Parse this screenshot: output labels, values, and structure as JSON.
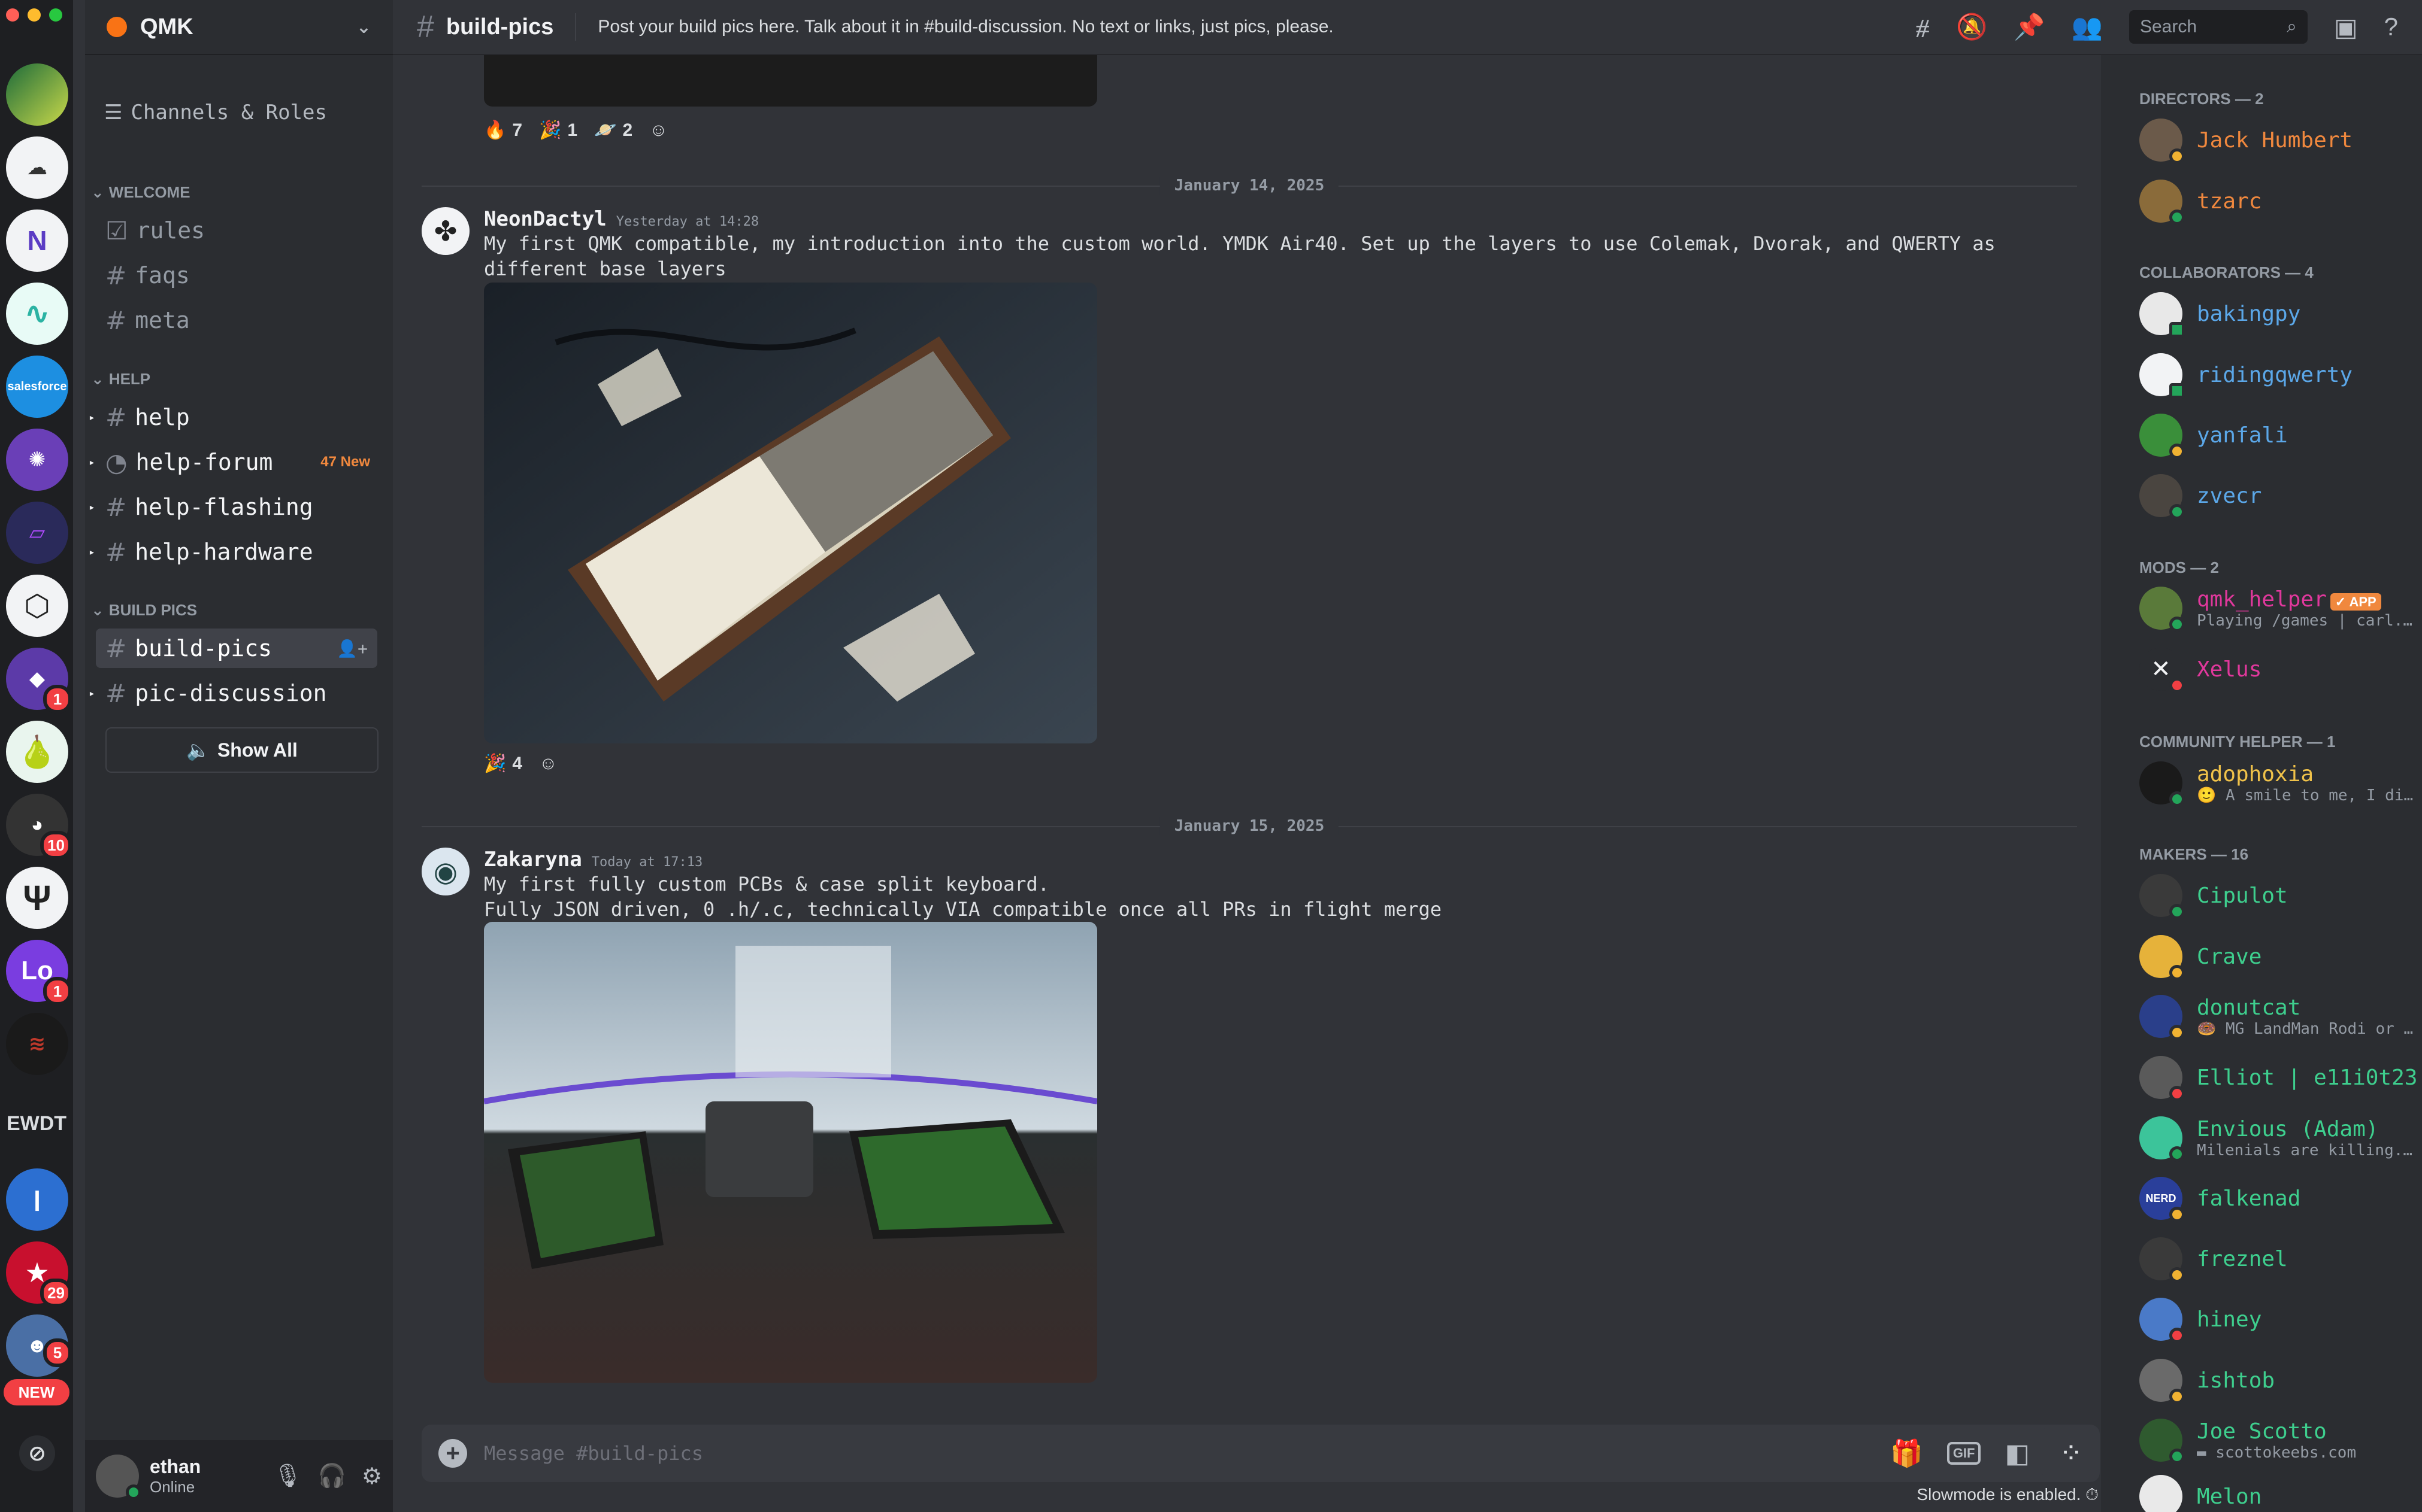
{
  "server": {
    "name": "QMK"
  },
  "channels_header": {
    "channels_roles": "Channels & Roles"
  },
  "categories": {
    "welcome": "WELCOME",
    "help": "HELP",
    "build": "BUILD PICS"
  },
  "channels": {
    "rules": "rules",
    "faqs": "faqs",
    "meta": "meta",
    "help": "help",
    "help_forum": "help-forum",
    "help_forum_new": "47 New",
    "help_flashing": "help-flashing",
    "help_hardware": "help-hardware",
    "build_pics": "build-pics",
    "pic_discussion": "pic-discussion"
  },
  "show_all": "Show All",
  "rail": {
    "ewdt": "EWDT",
    "new": "NEW",
    "badges": [
      "1",
      "10",
      "1",
      "29",
      "5"
    ]
  },
  "user": {
    "name": "ethan",
    "status": "Online"
  },
  "topbar": {
    "channel": "build-pics",
    "topic": "Post your build pics here. Talk about it in #build-discussion. No text or links, just pics, please.",
    "search_placeholder": "Search"
  },
  "messages": {
    "top_reactions": [
      {
        "emoji": "🔥",
        "count": "7"
      },
      {
        "emoji": "🎉",
        "count": "1"
      },
      {
        "emoji": "🪐",
        "count": "2"
      }
    ],
    "date1": "January 14, 2025",
    "m1": {
      "author": "NeonDactyl",
      "time": "Yesterday at 14:28",
      "text": "My first QMK compatible, my introduction into the custom world. YMDK Air40. Set up the layers to use Colemak, Dvorak, and QWERTY as\ndifferent base layers",
      "reactions": [
        {
          "emoji": "🎉",
          "count": "4"
        }
      ]
    },
    "date2": "January 15, 2025",
    "m2": {
      "author": "Zakaryna",
      "time": "Today at 17:13",
      "text": "My first fully custom PCBs & case split keyboard.\nFully JSON driven, 0 .h/.c, technically VIA compatible once all PRs in flight merge"
    }
  },
  "composer": {
    "placeholder": "Message #build-pics",
    "gif": "GIF"
  },
  "slowmode": "Slowmode is enabled.",
  "members": {
    "directors": "DIRECTORS — 2",
    "collaborators": "COLLABORATORS — 4",
    "mods": "MODS — 2",
    "helpers": "COMMUNITY HELPER — 1",
    "makers": "MAKERS — 16",
    "list": {
      "jack": {
        "name": "Jack Humbert"
      },
      "tzarc": {
        "name": "tzarc"
      },
      "bakingpy": {
        "name": "bakingpy"
      },
      "ridingqwerty": {
        "name": "ridingqwerty"
      },
      "yanfali": {
        "name": "yanfali"
      },
      "zvecr": {
        "name": "zvecr"
      },
      "qmk_helper": {
        "name": "qmk_helper",
        "tag": "✓ APP",
        "sub": "Playing /games | carl..."
      },
      "xelus": {
        "name": "Xelus"
      },
      "adophoxia": {
        "name": "adophoxia",
        "sub": "🙂 A smile to me, I di..."
      },
      "cipulot": {
        "name": "Cipulot"
      },
      "crave": {
        "name": "Crave"
      },
      "donutcat": {
        "name": "donutcat",
        "sub": "🍩 MG LandMan Rodi or ..."
      },
      "elliot": {
        "name": "Elliot | e11i0t23"
      },
      "envious": {
        "name": "Envious (Adam)",
        "sub": "Milenials are killing..."
      },
      "falkenad": {
        "name": "falkenad"
      },
      "freznel": {
        "name": "freznel"
      },
      "hiney": {
        "name": "hiney"
      },
      "ishtob": {
        "name": "ishtob"
      },
      "joe": {
        "name": "Joe Scotto",
        "sub": "▬ scottokeebs.com"
      },
      "melon": {
        "name": "Melon"
      }
    }
  },
  "colors": {
    "accent": "#5865f2",
    "director": "#f0883e",
    "collaborator": "#5ba7e8",
    "mod": "#e0389c",
    "helper": "#f0c24a",
    "maker": "#3ecf8e"
  }
}
